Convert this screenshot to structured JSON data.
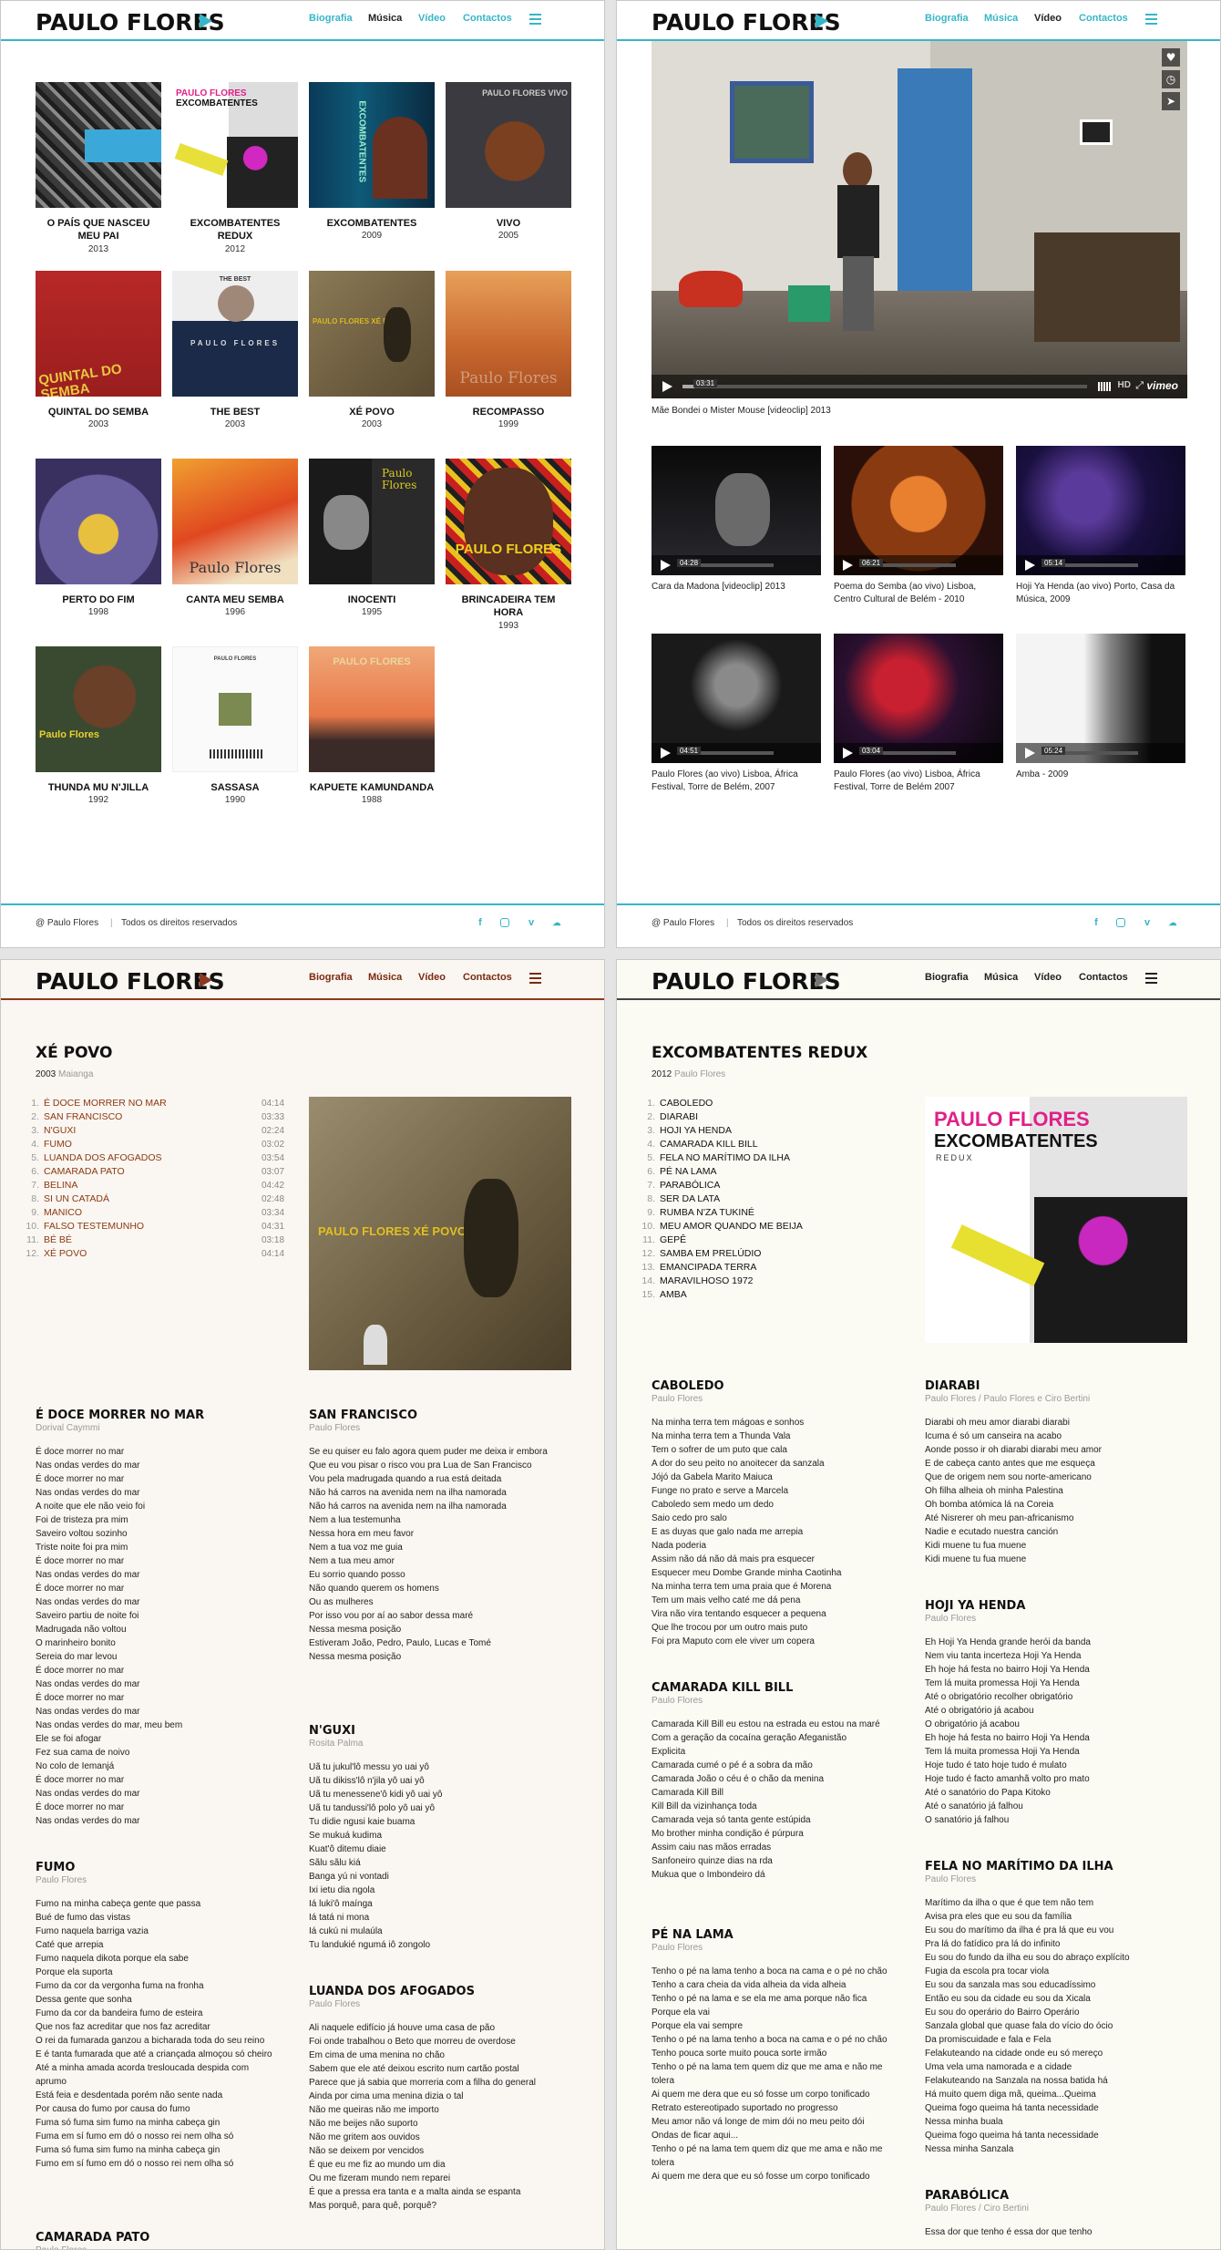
{
  "brand": "PAULO FLORES",
  "nav": [
    "Biografia",
    "Música",
    "Vídeo",
    "Contactos"
  ],
  "discography": [
    {
      "title": "O PAÍS QUE NASCEU MEU PAI",
      "year": "2013"
    },
    {
      "title": "EXCOMBATENTES REDUX",
      "year": "2012"
    },
    {
      "title": "EXCOMBATENTES",
      "year": "2009"
    },
    {
      "title": "VIVO",
      "year": "2005"
    },
    {
      "title": "QUINTAL DO SEMBA",
      "year": "2003"
    },
    {
      "title": "THE BEST",
      "year": "2003"
    },
    {
      "title": "XÉ POVO",
      "year": "2003"
    },
    {
      "title": "RECOMPASSO",
      "year": "1999"
    },
    {
      "title": "PERTO DO FIM",
      "year": "1998"
    },
    {
      "title": "CANTA MEU SEMBA",
      "year": "1996"
    },
    {
      "title": "INOCENTI",
      "year": "1995"
    },
    {
      "title": "BRINCADEIRA TEM HORA",
      "year": "1993"
    },
    {
      "title": "THUNDA MU N'JILLA",
      "year": "1992"
    },
    {
      "title": "SASSASA",
      "year": "1990"
    },
    {
      "title": "KAPUETE KAMUNDANDA",
      "year": "1988"
    }
  ],
  "cover_text": {
    "c2": "PAULO FLORES",
    "c2b": "EXCOMBATENTES",
    "c3": "EXCOMBATENTES",
    "c4": "PAULO FLORES VIVO",
    "c5": "QUINTAL DO SEMBA",
    "c6": "THE BEST",
    "c6b": "PAULO FLORES",
    "c7": "PAULO FLORES XÉ POVO",
    "c8": "Paulo Flores",
    "c10": "Paulo Flores",
    "c11": "Paulo Flores",
    "c12": "PAULO FLORES",
    "c13": "Paulo Flores",
    "c14": "PAULO FLORES",
    "c15": "PAULO FLORES"
  },
  "footer": {
    "copyright": "@ Paulo Flores",
    "rights": "Todos os direitos reservados"
  },
  "video": {
    "main_caption": "Mãe Bondei o Mister Mouse [videoclip] 2013",
    "main_time": "03:31",
    "hd": "HD",
    "vimeo": "vimeo",
    "thumbs": [
      {
        "caption": "Cara da Madona [videoclip] 2013",
        "time": "04:28"
      },
      {
        "caption": "Poema do Semba (ao vivo) Lisboa, Centro Cultural de Belém - 2010",
        "time": "06:21"
      },
      {
        "caption": "Hoji Ya Henda (ao vivo) Porto, Casa da Música, 2009",
        "time": "05:14"
      },
      {
        "caption": "Paulo Flores (ao vivo) Lisboa, África Festival, Torre de Belém, 2007",
        "time": "04:51"
      },
      {
        "caption": "Paulo Flores (ao vivo) Lisboa, África Festival, Torre de Belém 2007",
        "time": "03:04"
      },
      {
        "caption": "Amba - 2009",
        "time": "05:24"
      }
    ]
  },
  "xepovo": {
    "title": "XÉ POVO",
    "year": "2003",
    "label": "Maianga",
    "tracks": [
      {
        "n": "1.",
        "t": "É DOCE MORRER NO MAR",
        "d": "04:14"
      },
      {
        "n": "2.",
        "t": "SAN FRANCISCO",
        "d": "03:33"
      },
      {
        "n": "3.",
        "t": "N'GUXI",
        "d": "02:24"
      },
      {
        "n": "4.",
        "t": "FUMO",
        "d": "03:02"
      },
      {
        "n": "5.",
        "t": "LUANDA DOS AFOGADOS",
        "d": "03:54"
      },
      {
        "n": "6.",
        "t": "CAMARADA PATO",
        "d": "03:07"
      },
      {
        "n": "7.",
        "t": "BELINA",
        "d": "04:42"
      },
      {
        "n": "8.",
        "t": "SI UN CATADÁ",
        "d": "02:48"
      },
      {
        "n": "9.",
        "t": "MANICO",
        "d": "03:34"
      },
      {
        "n": "10.",
        "t": "FALSO TESTEMUNHO",
        "d": "04:31"
      },
      {
        "n": "11.",
        "t": "BÉ BÉ",
        "d": "03:18"
      },
      {
        "n": "12.",
        "t": "XÉ POVO",
        "d": "04:14"
      }
    ],
    "songs": [
      {
        "title": "É DOCE MORRER NO MAR",
        "author": "Dorival Caymmi",
        "lines": [
          "É doce morrer no mar",
          "Nas ondas verdes do mar",
          "É doce morrer no mar",
          "Nas ondas verdes do mar",
          "A noite que ele não veio foi",
          "Foi de tristeza pra mim",
          "Saveiro voltou sozinho",
          "Triste noite foi pra mim",
          "É doce morrer no mar",
          "Nas ondas verdes do mar",
          "É doce morrer no mar",
          "Nas ondas verdes do mar",
          "Saveiro partiu de noite foi",
          "Madrugada não voltou",
          "O marinheiro bonito",
          "Sereia do mar levou",
          "É doce morrer no mar",
          "Nas ondas verdes do mar",
          "É doce morrer no mar",
          "Nas ondas verdes do mar",
          "Nas ondas verdes do mar, meu bem",
          "Ele se foi afogar",
          "Fez sua cama de noivo",
          "No colo de Iemanjá",
          "É doce morrer no mar",
          "Nas ondas verdes do mar",
          "É doce morrer no mar",
          "Nas ondas verdes do mar"
        ]
      },
      {
        "title": "SAN FRANCISCO",
        "author": "Paulo Flores",
        "lines": [
          "Se eu quiser eu falo agora quem puder me deixa ir embora",
          "Que eu vou pisar o risco vou pra Lua de San Francisco",
          "Vou pela madrugada quando a rua está deitada",
          "Não há carros na avenida nem na ilha namorada",
          "Não há carros na avenida nem na ilha namorada",
          "Nem a lua testemunha",
          "Nessa hora em meu favor",
          "Nem a tua voz me guia",
          "Nem a tua meu amor",
          "Eu sorrio quando posso",
          "Não quando querem os homens",
          "Ou as mulheres",
          "Por isso vou por aí ao sabor dessa maré",
          "Nessa mesma posição",
          "Estiveram João, Pedro, Paulo, Lucas e Tomé",
          "Nessa mesma posição"
        ]
      },
      {
        "title": "N'GUXI",
        "author": "Rosita Palma",
        "lines": [
          "Uã tu jukul'lô messu yo uai yô",
          "Uã tu dikiss'lô n'jila yô uai yô",
          "Uã tu menessene'ô kidi yô uai yô",
          "Uã tu tandussi'lô polo yô uai yô",
          "Tu didie ngusi kaie buama",
          "Se mukuá kudima",
          "Kuat'ô ditemu diaie",
          "Sãlu sãlu kiá",
          "Banga yú ni vontadi",
          "Ixi ietu dia ngola",
          "Iá luki'ô maínga",
          "Iá tatá ni mona",
          "Iá cukú ni mulaúla",
          "Tu landukié ngumá iô zongolo"
        ]
      },
      {
        "title": "FUMO",
        "author": "Paulo Flores",
        "lines": [
          "Fumo na minha cabeça gente que passa",
          "Bué de fumo das vistas",
          "Fumo naquela barriga vazia",
          "Caté que arrepia",
          "Fumo naquela dikota porque ela sabe",
          "Porque ela suporta",
          "Fumo da cor da vergonha fuma na fronha",
          "Dessa gente que sonha",
          "Fumo da cor da bandeira fumo de esteira",
          "Que nos faz acreditar que nos faz acreditar",
          "O rei da fumarada ganzou a bicharada toda do seu reino",
          "E é tanta fumarada que até a criançada almoçou só cheiro",
          "Até a minha amada acorda tresloucada despida com aprumo",
          "Está feia e desdentada porém não sente nada",
          "Por causa do fumo por causa do fumo",
          "Fuma só fuma sim fumo na minha cabeça gin",
          "Fuma em sí fumo em dó o nosso rei nem olha só",
          "Fuma só fuma sim fumo na minha cabeça gin",
          "Fumo em sí fumo em dó o nosso rei nem olha só"
        ]
      },
      {
        "title": "LUANDA DOS AFOGADOS",
        "author": "Paulo Flores",
        "lines": [
          "Ali naquele edifício já houve uma casa de pão",
          "Foi onde trabalhou o Beto que morreu de overdose",
          "Em cima de uma menina no chão",
          "Sabem que ele até deixou escrito num cartão postal",
          "Parece que já sabia que morreria com a filha do general",
          "Ainda por cima uma menina dizia o tal",
          "Não me queiras não me importo",
          "Não me beijes não suporto",
          "Não me gritem aos ouvidos",
          "Não se deixem por vencidos",
          "É que eu me fiz ao mundo um dia",
          "Ou me fizeram mundo nem reparei",
          "É que a pressa era tanta e a malta ainda se espanta",
          "Mas porquê, para quê, porquê?"
        ]
      },
      {
        "title": "CAMARADA PATO",
        "author": "Paulo Flores",
        "lines": []
      }
    ]
  },
  "redux": {
    "title": "EXCOMBATENTES REDUX",
    "year": "2012",
    "label": "Paulo Flores",
    "cover_title": "PAULO FLORES",
    "cover_sub": "EXCOMBATENTES",
    "cover_redux": "REDUX",
    "tracks": [
      {
        "n": "1.",
        "t": "CABOLEDO"
      },
      {
        "n": "2.",
        "t": "DIARABI"
      },
      {
        "n": "3.",
        "t": "HOJI YA HENDA"
      },
      {
        "n": "4.",
        "t": "CAMARADA KILL BILL"
      },
      {
        "n": "5.",
        "t": "FELA NO MARÍTIMO DA ILHA"
      },
      {
        "n": "6.",
        "t": "PÉ NA LAMA"
      },
      {
        "n": "7.",
        "t": "PARABÓLICA"
      },
      {
        "n": "8.",
        "t": "SER DA LATA"
      },
      {
        "n": "9.",
        "t": "RUMBA N'ZA TUKINÉ"
      },
      {
        "n": "10.",
        "t": "MEU AMOR QUANDO ME BEIJA"
      },
      {
        "n": "11.",
        "t": "GEPÊ"
      },
      {
        "n": "12.",
        "t": "SAMBA EM PRELÚDIO"
      },
      {
        "n": "13.",
        "t": "EMANCIPADA TERRA"
      },
      {
        "n": "14.",
        "t": "MARAVILHOSO 1972"
      },
      {
        "n": "15.",
        "t": "AMBA"
      }
    ],
    "songs": [
      {
        "title": "CABOLEDO",
        "author": "Paulo Flores",
        "lines": [
          "Na minha terra tem mágoas e sonhos",
          "Na minha terra tem a Thunda Vala",
          "Tem o sofrer de um puto que cala",
          "A dor do seu peito no anoitecer da sanzala",
          "Jójó da Gabela Marito Maiuca",
          "Funge no prato e serve a Marcela",
          "Caboledo sem medo um dedo",
          "Saio cedo pro salo",
          "E as duyas que galo nada me arrepia",
          "Nada poderia",
          "Assim não dá não dá mais pra esquecer",
          "Esquecer meu Dombe Grande minha Caotinha",
          "Na minha terra tem uma praia que é Morena",
          "Tem um mais velho caté me dá pena",
          "Vira não vira tentando esquecer a pequena",
          "Que lhe trocou por um outro mais puto",
          "Foi pra Maputo com ele viver um copera"
        ]
      },
      {
        "title": "DIARABI",
        "author": "Paulo Flores / Paulo Flores e Ciro Bertini",
        "lines": [
          "Diarabi oh meu amor diarabi diarabi",
          "Icuma é só um canseira na acabo",
          "Aonde posso ir oh diarabi diarabi meu amor",
          "E de cabeça canto antes que me esqueça",
          "Que de origem nem sou norte-americano",
          "Oh filha alheia oh minha Palestina",
          "Oh bomba atómica lá na Coreia",
          "Até Nisrerer oh meu pan-africanismo",
          "Nadie e ecutado nuestra canción",
          "Kidi muene tu fua muene",
          "Kidi muene tu fua muene"
        ]
      },
      {
        "title": "CAMARADA KILL BILL",
        "author": "Paulo Flores",
        "lines": [
          "Camarada Kill Bill eu estou na estrada eu estou na maré",
          "Com a geração da cocaína geração Afeganistão",
          "Explicita",
          "Camarada cumé o pé é a sobra da mão",
          "Camarada João o céu é o chão da menina",
          "Camarada Kill Bill",
          "Kill Bill da vizinhança toda",
          "Camarada veja só tanta gente estúpida",
          "Mo brother minha condição é púrpura",
          "Assim caiu nas mãos erradas",
          "Sanfoneiro quinze dias na rda",
          "Mukua que o Imbondeiro dá"
        ]
      },
      {
        "title": "HOJI YA HENDA",
        "author": "Paulo Flores",
        "lines": [
          "Eh Hoji Ya Henda grande herói da banda",
          "Nem viu tanta incerteza Hoji Ya Henda",
          "Eh hoje há festa no bairro Hoji Ya Henda",
          "Tem lá muita promessa Hoji Ya Henda",
          "Até o obrigatório recolher obrigatório",
          "Até o obrigatório já acabou",
          "O obrigatório já acabou",
          "Eh hoje há festa no bairro Hoji Ya Henda",
          "Tem lá muita promessa Hoji Ya Henda",
          "Hoje tudo é tato hoje tudo é mulato",
          "Hoje tudo é facto amanhã volto pro mato",
          "Até o sanatório do Papa Kitoko",
          "Até o sanatório já falhou",
          "O sanatório já falhou"
        ]
      },
      {
        "title": "PÉ NA LAMA",
        "author": "Paulo Flores",
        "lines": [
          "Tenho o pé na lama tenho a boca na cama e o pé no chão",
          "Tenho a cara cheia da vida alheia da vida alheia",
          "Tenho o pé na lama e se ela me ama porque não fica",
          "Porque ela vai",
          "Porque ela vai sempre",
          "Tenho o pé na lama tenho a boca na cama e o pé no chão",
          "Tenho pouca sorte muito pouca sorte irmão",
          "Tenho o pé na lama tem quem diz que me ama e não me tolera",
          "Ai quem me dera que eu só fosse um corpo tonificado",
          "Retrato estereotipado suportado no progresso",
          "Meu amor não vá longe de mim dói no meu peito dói",
          "Ondas de ficar aqui...",
          "Tenho o pé na lama tem quem diz que me ama e não me tolera",
          "Ai quem me dera que eu só fosse um corpo tonificado"
        ]
      },
      {
        "title": "FELA NO MARÍTIMO DA ILHA",
        "author": "Paulo Flores",
        "lines": [
          "Marítimo da ilha o que é que tem não tem",
          "Avisa pra eles que eu sou da família",
          "Eu sou do marítimo da ilha é pra lá que eu vou",
          "Pra lá do fatídico pra lá do infinito",
          "Eu sou do fundo da ilha eu sou do abraço explícito",
          "Fugia da escola pra tocar viola",
          "Eu sou da sanzala mas sou educadíssimo",
          "Então eu sou da cidade eu sou da Xicala",
          "Eu sou do operário do Bairro Operário",
          "Sanzala global que quase fala do vício do ócio",
          "Da promiscuidade e fala e Fela",
          "Felakuteando na cidade onde eu só mereço",
          "Uma vela uma namorada e a cidade",
          "Felakuteando na Sanzala na nossa batida há",
          "Há muito quem diga mã, queima...Queima",
          "Queima fogo queima há tanta necessidade",
          "Nessa minha buala",
          "Queima fogo queima há tanta necessidade",
          "Nessa minha Sanzala"
        ]
      },
      {
        "title": "PARABÓLICA",
        "author": "Paulo Flores / Ciro Bertini",
        "lines": [
          "Essa dor que tenho é essa dor que tenho"
        ]
      }
    ]
  }
}
